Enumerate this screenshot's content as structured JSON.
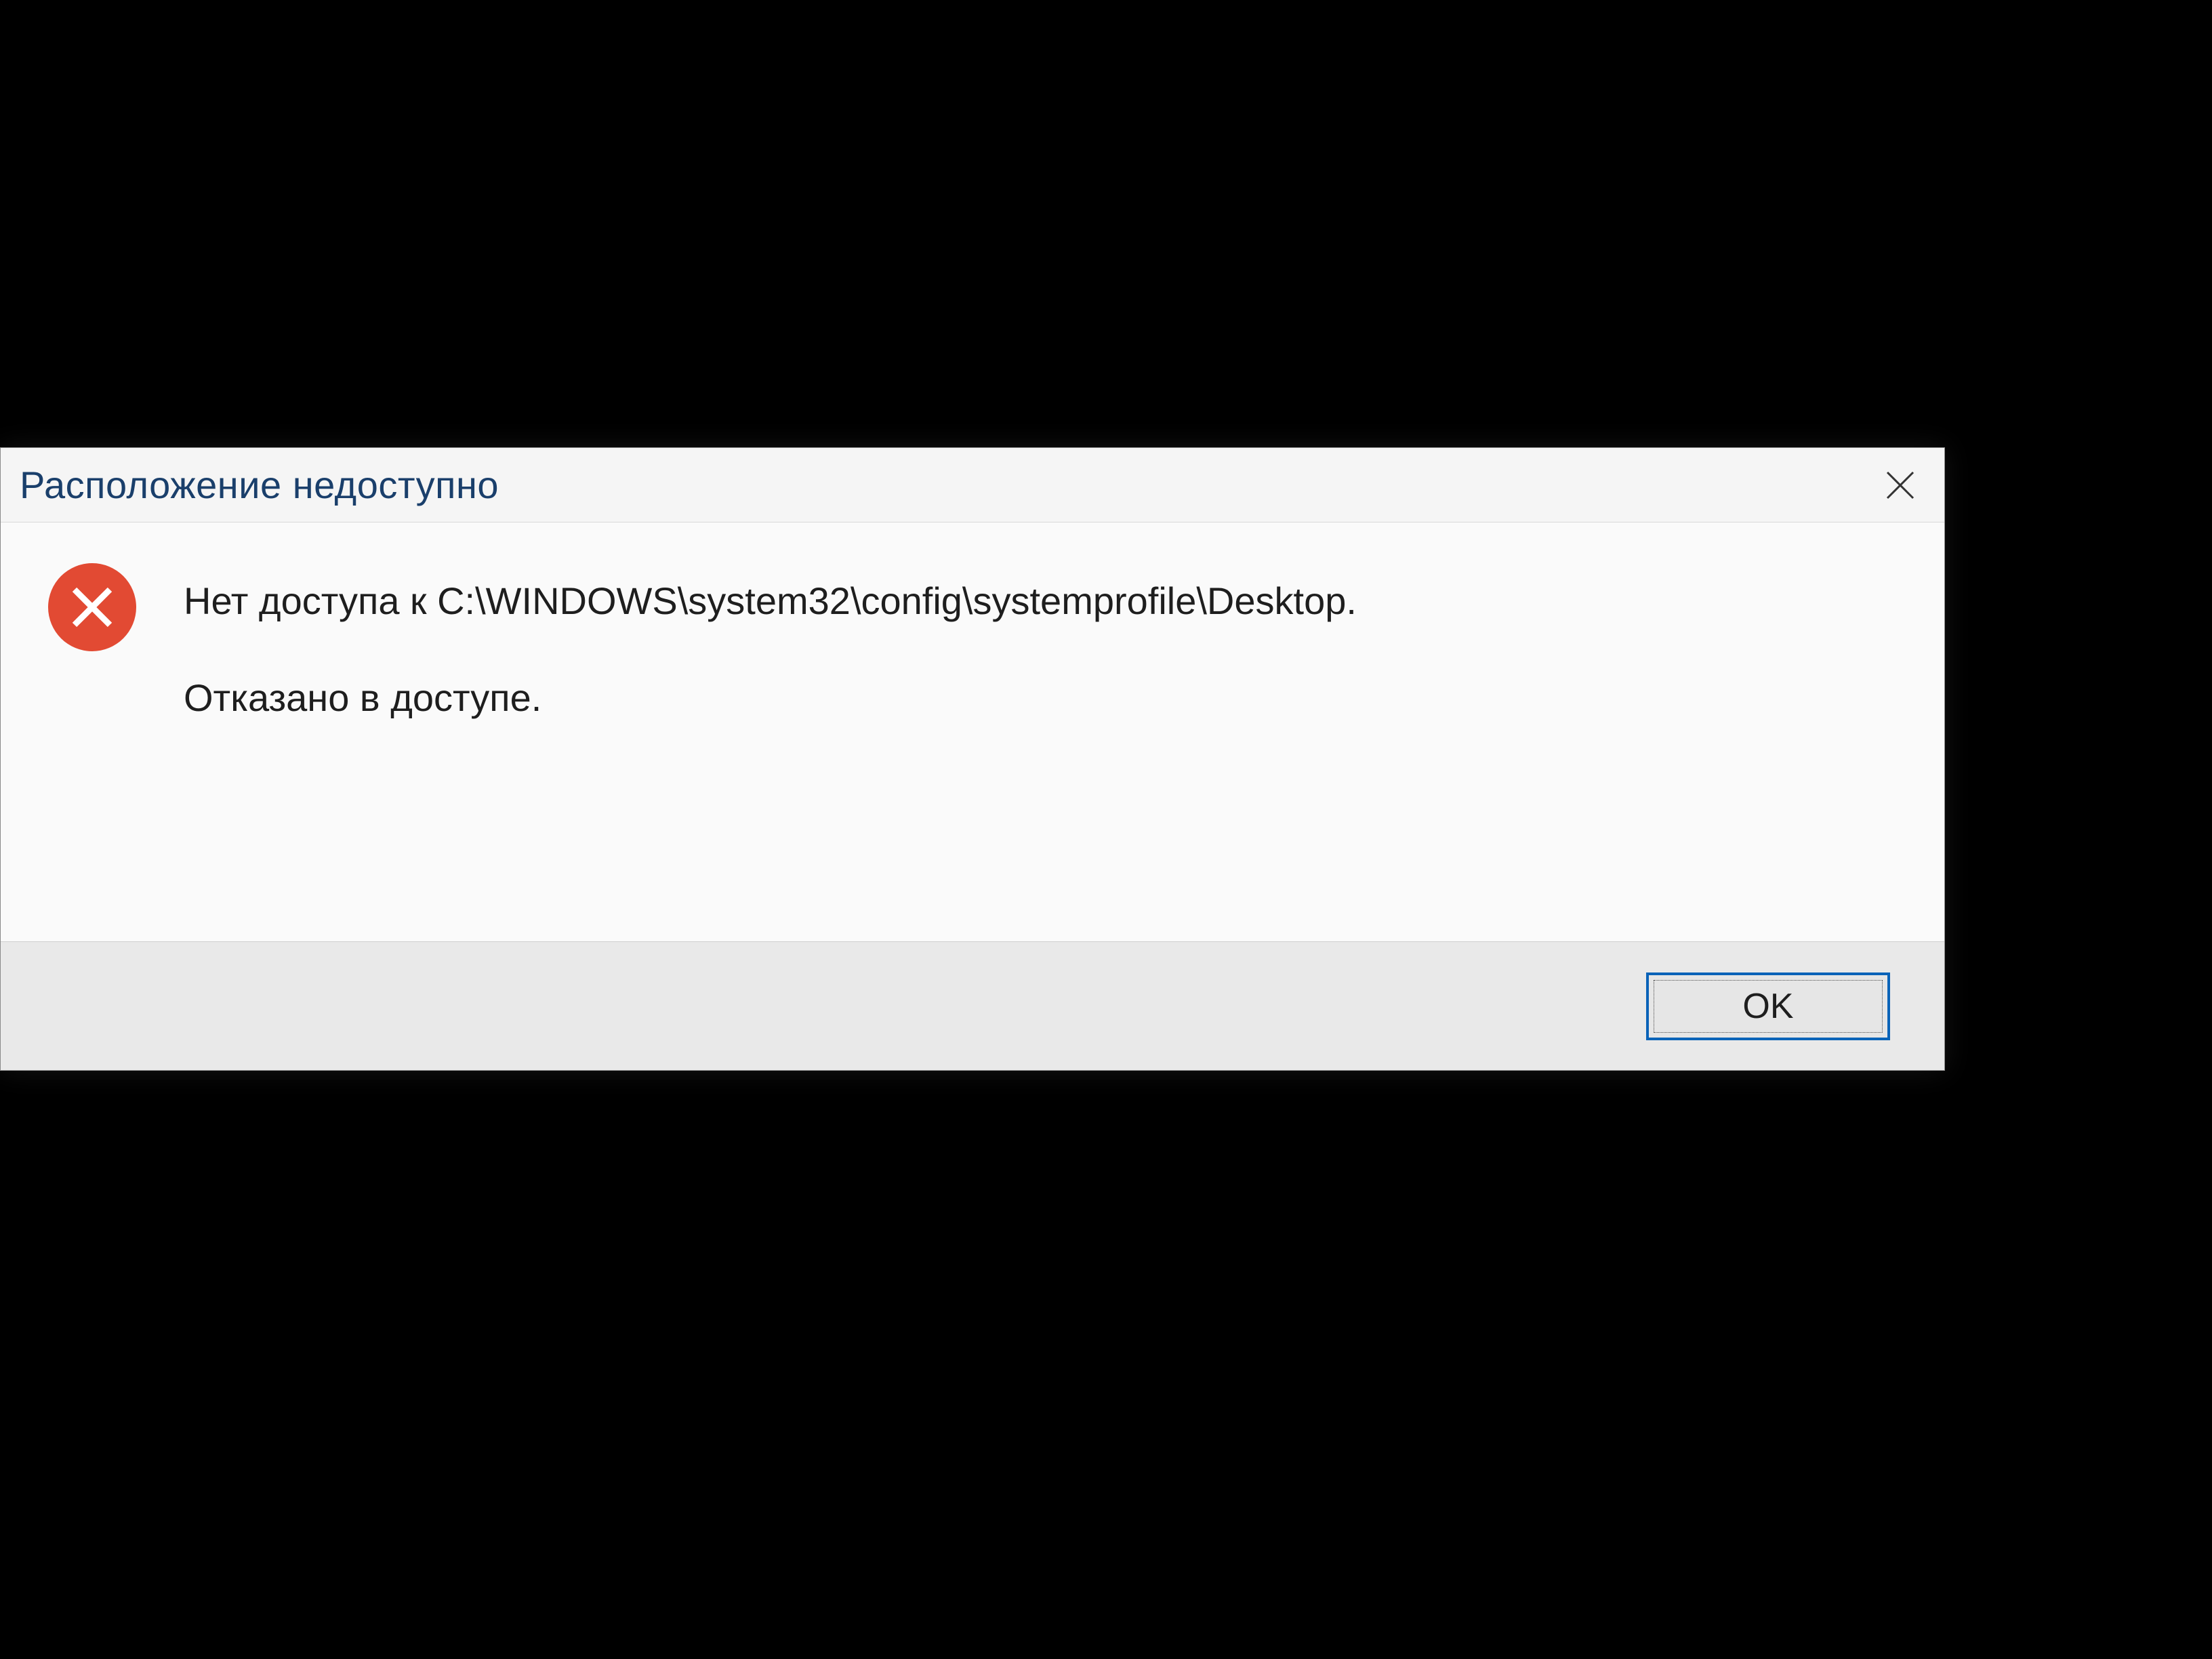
{
  "dialog": {
    "title": "Расположение недоступно",
    "message_main": "Нет доступа к C:\\WINDOWS\\system32\\config\\systemprofile\\Desktop.",
    "message_sub": "Отказано в доступе.",
    "ok_label": "OK",
    "icon": "error-x",
    "colors": {
      "accent_error": "#e24a33",
      "button_focus_border": "#0a63b8",
      "title_text": "#1a3f6b"
    }
  }
}
